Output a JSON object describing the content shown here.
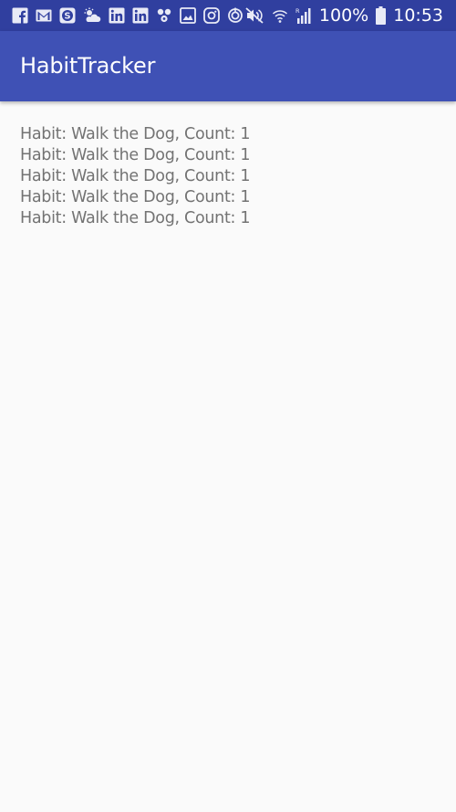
{
  "status_bar": {
    "icons": [
      "facebook-icon",
      "gmail-icon",
      "skype-icon",
      "weather-icon",
      "linkedin-icon",
      "linkedin-icon",
      "tinder-icon",
      "gallery-icon",
      "instagram-icon",
      "sync-icon"
    ],
    "battery": "100%",
    "time": "10:53",
    "color": "#303f9f"
  },
  "app_bar": {
    "title": "HabitTracker",
    "color": "#3f51b5"
  },
  "habits": [
    "Habit: Walk the Dog, Count: 1",
    "Habit: Walk the Dog, Count: 1",
    "Habit: Walk the Dog, Count: 1",
    "Habit: Walk the Dog, Count: 1",
    "Habit: Walk the Dog, Count: 1"
  ]
}
